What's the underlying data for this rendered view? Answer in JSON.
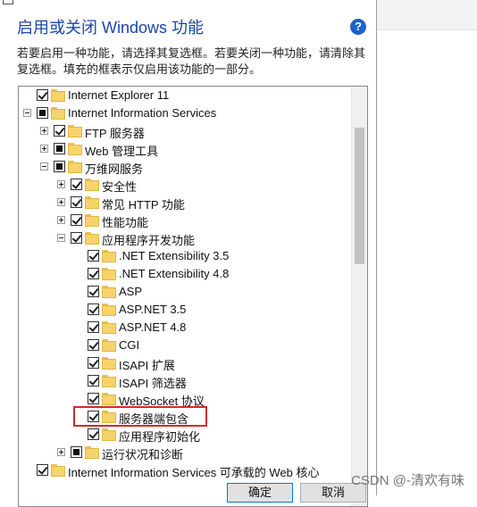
{
  "dialog": {
    "title": "启用或关闭 Windows 功能",
    "help_icon": "?",
    "description": "若要启用一种功能，请选择其复选框。若要关闭一种功能，请清除其复选框。填充的框表示仅启用该功能的一部分。"
  },
  "tree": {
    "items": [
      {
        "label": "Internet Explorer 11",
        "level": 0,
        "expander": "none",
        "state": "checked"
      },
      {
        "label": "Internet Information Services",
        "level": 0,
        "expander": "minus",
        "state": "partial"
      },
      {
        "label": "FTP 服务器",
        "level": 1,
        "expander": "plus",
        "state": "checked"
      },
      {
        "label": "Web 管理工具",
        "level": 1,
        "expander": "plus",
        "state": "partial"
      },
      {
        "label": "万维网服务",
        "level": 1,
        "expander": "minus",
        "state": "partial"
      },
      {
        "label": "安全性",
        "level": 2,
        "expander": "plus",
        "state": "checked"
      },
      {
        "label": "常见 HTTP 功能",
        "level": 2,
        "expander": "plus",
        "state": "checked"
      },
      {
        "label": "性能功能",
        "level": 2,
        "expander": "plus",
        "state": "checked"
      },
      {
        "label": "应用程序开发功能",
        "level": 2,
        "expander": "minus",
        "state": "checked"
      },
      {
        "label": ".NET Extensibility 3.5",
        "level": 3,
        "expander": "none",
        "state": "checked"
      },
      {
        "label": ".NET Extensibility 4.8",
        "level": 3,
        "expander": "none",
        "state": "checked"
      },
      {
        "label": "ASP",
        "level": 3,
        "expander": "none",
        "state": "checked"
      },
      {
        "label": "ASP.NET 3.5",
        "level": 3,
        "expander": "none",
        "state": "checked"
      },
      {
        "label": "ASP.NET 4.8",
        "level": 3,
        "expander": "none",
        "state": "checked"
      },
      {
        "label": "CGI",
        "level": 3,
        "expander": "none",
        "state": "checked"
      },
      {
        "label": "ISAPI 扩展",
        "level": 3,
        "expander": "none",
        "state": "checked"
      },
      {
        "label": "ISAPI 筛选器",
        "level": 3,
        "expander": "none",
        "state": "checked"
      },
      {
        "label": "WebSocket 协议",
        "level": 3,
        "expander": "none",
        "state": "checked"
      },
      {
        "label": "服务器端包含",
        "level": 3,
        "expander": "none",
        "state": "checked"
      },
      {
        "label": "应用程序初始化",
        "level": 3,
        "expander": "none",
        "state": "checked"
      },
      {
        "label": "运行状况和诊断",
        "level": 2,
        "expander": "plus",
        "state": "partial"
      },
      {
        "label": "Internet Information Services 可承载的 Web 核心",
        "level": 0,
        "expander": "none",
        "state": "checked"
      }
    ]
  },
  "buttons": {
    "ok_label": "确定",
    "cancel_label": "取消"
  },
  "watermark": "CSDN @-清欢有味",
  "colors": {
    "title": "#1a46a8",
    "highlight": "#d42a2a",
    "folder": "#f7d36b"
  }
}
